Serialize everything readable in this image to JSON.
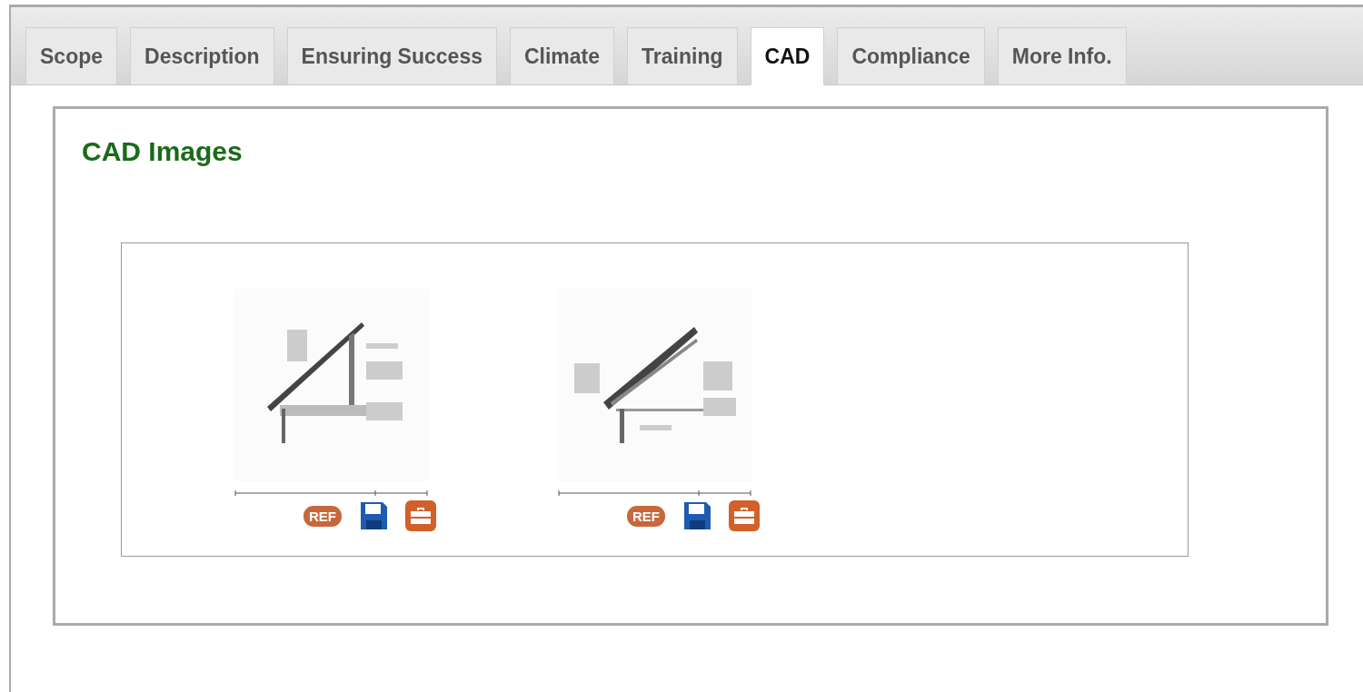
{
  "tabs": [
    {
      "label": "Scope",
      "selected": false
    },
    {
      "label": "Description",
      "selected": false
    },
    {
      "label": "Ensuring Success",
      "selected": false
    },
    {
      "label": "Climate",
      "selected": false
    },
    {
      "label": "Training",
      "selected": false
    },
    {
      "label": "CAD",
      "selected": true
    },
    {
      "label": "Compliance",
      "selected": false
    },
    {
      "label": "More Info.",
      "selected": false
    }
  ],
  "panel": {
    "title": "CAD Images",
    "items": [
      {
        "kind": "picture",
        "ref_label": "REF"
      },
      {
        "kind": "picture",
        "ref_label": "REF"
      }
    ]
  }
}
